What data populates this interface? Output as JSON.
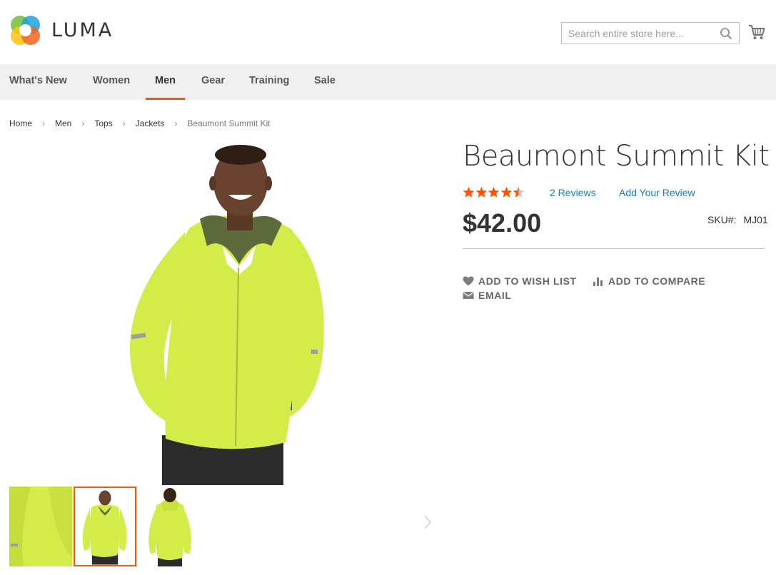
{
  "header": {
    "logo_text": "LUMA",
    "search_placeholder": "Search entire store here..."
  },
  "nav": {
    "items": [
      {
        "label": "What's New",
        "active": false
      },
      {
        "label": "Women",
        "active": false
      },
      {
        "label": "Men",
        "active": true
      },
      {
        "label": "Gear",
        "active": false
      },
      {
        "label": "Training",
        "active": false
      },
      {
        "label": "Sale",
        "active": false
      }
    ]
  },
  "breadcrumb": {
    "items": [
      "Home",
      "Men",
      "Tops",
      "Jackets"
    ],
    "current": "Beaumont Summit Kit",
    "separator": "›"
  },
  "product": {
    "title": "Beaumont Summit Kit",
    "rating_fraction": 0.9,
    "reviews_label": "2 Reviews",
    "add_review_label": "Add Your Review",
    "price": "$42.00",
    "sku_label": "SKU#:",
    "sku_value": "MJ01",
    "actions": {
      "wishlist": "ADD TO WISH LIST",
      "compare": "ADD TO COMPARE",
      "email": "EMAIL"
    }
  },
  "gallery": {
    "active_thumb_index": 1,
    "thumb_count": 3
  },
  "colors": {
    "accent": "#ff5501",
    "link": "#1979c3",
    "jacket": "#d4ec4a",
    "nav_bg": "#f0f0f0"
  }
}
